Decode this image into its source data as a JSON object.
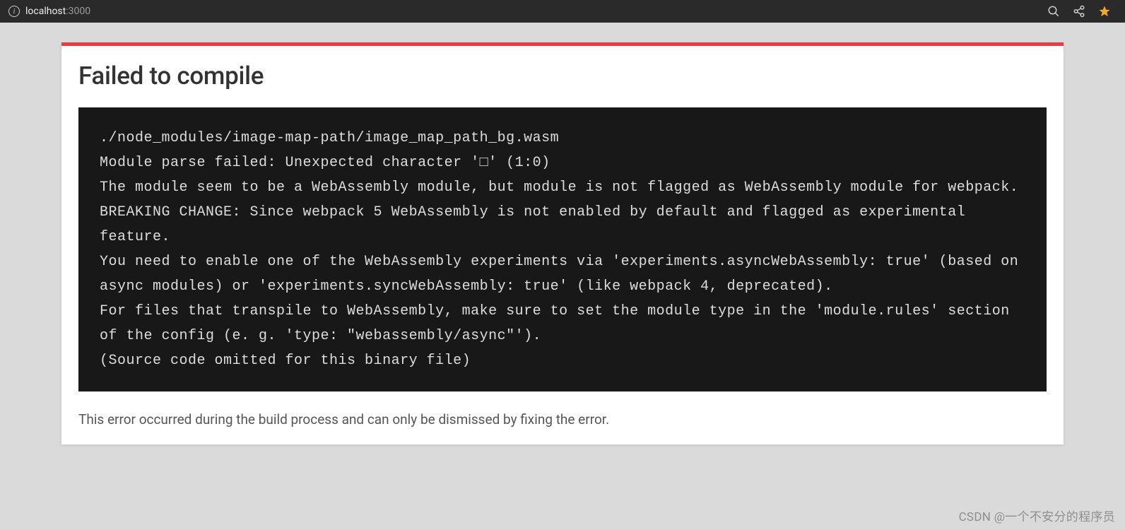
{
  "browser": {
    "url_host": "localhost",
    "url_port": ":3000"
  },
  "error": {
    "title": "Failed to compile",
    "code": "./node_modules/image-map-path/image_map_path_bg.wasm\nModule parse failed: Unexpected character '□' (1:0)\nThe module seem to be a WebAssembly module, but module is not flagged as WebAssembly module for webpack.\nBREAKING CHANGE: Since webpack 5 WebAssembly is not enabled by default and flagged as experimental feature.\nYou need to enable one of the WebAssembly experiments via 'experiments.asyncWebAssembly: true' (based on async modules) or 'experiments.syncWebAssembly: true' (like webpack 4, deprecated).\nFor files that transpile to WebAssembly, make sure to set the module type in the 'module.rules' section of the config (e. g. 'type: \"webassembly/async\"').\n(Source code omitted for this binary file)",
    "footer": "This error occurred during the build process and can only be dismissed by fixing the error."
  },
  "watermark": "CSDN @一个不安分的程序员"
}
